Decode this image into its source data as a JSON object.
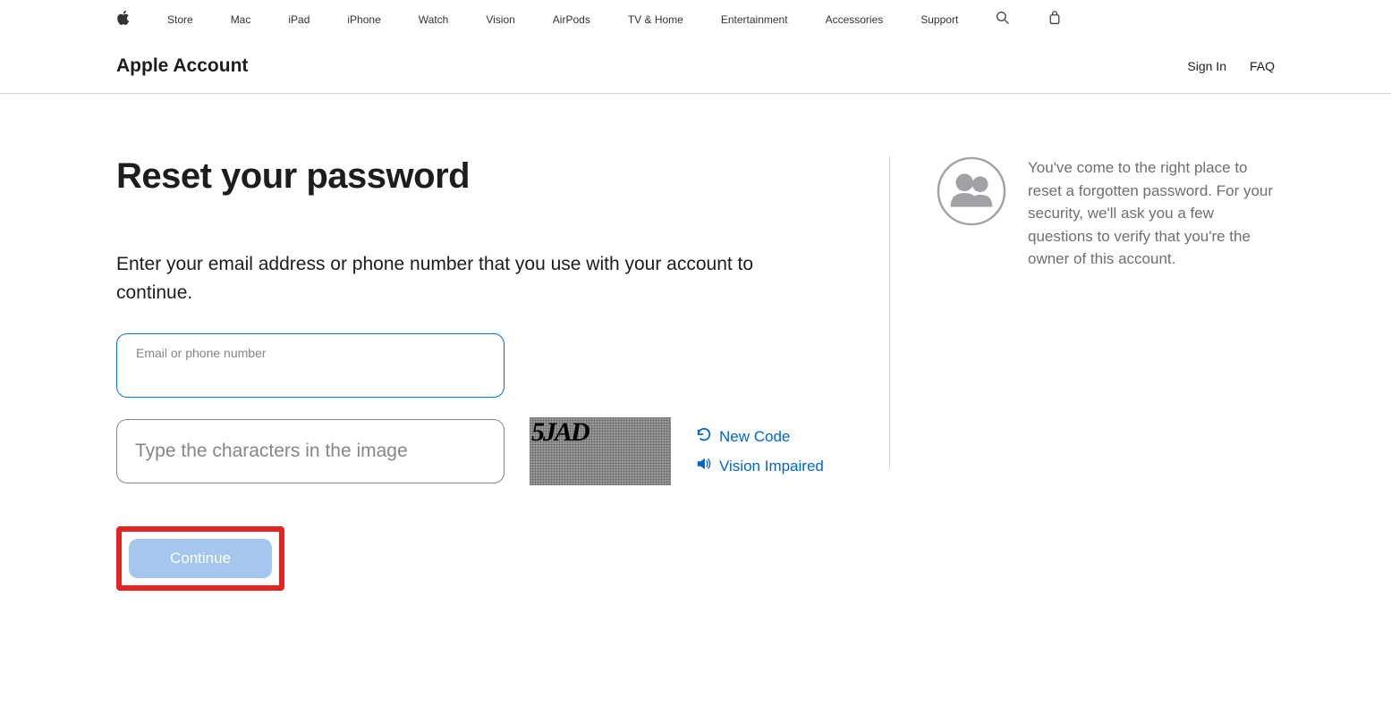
{
  "globalNav": {
    "items": [
      "Store",
      "Mac",
      "iPad",
      "iPhone",
      "Watch",
      "Vision",
      "AirPods",
      "TV & Home",
      "Entertainment",
      "Accessories",
      "Support"
    ]
  },
  "subNav": {
    "title": "Apple Account",
    "signIn": "Sign In",
    "faq": "FAQ"
  },
  "page": {
    "heading": "Reset your password",
    "instructions": "Enter your email address or phone number that you use with your account to continue."
  },
  "form": {
    "emailLabel": "Email or phone number",
    "captchaPlaceholder": "Type the characters in the image",
    "captchaText": "5JAD",
    "newCode": "New Code",
    "visionImpaired": "Vision Impaired",
    "continueLabel": "Continue"
  },
  "sidebar": {
    "infoText": "You've come to the right place to reset a forgotten password. For your security, we'll ask you a few questions to verify that you're the owner of this account."
  }
}
